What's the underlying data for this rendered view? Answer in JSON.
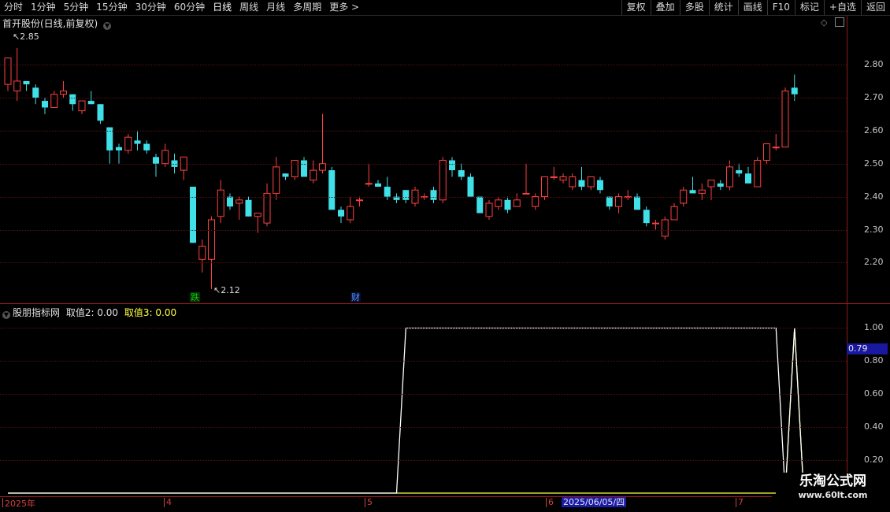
{
  "toolbar": {
    "periods": [
      "分时",
      "1分钟",
      "5分钟",
      "15分钟",
      "30分钟",
      "60分钟",
      "日线",
      "周线",
      "月线",
      "多周期",
      "更多 >"
    ],
    "active_period": "日线",
    "actions": [
      "复权",
      "叠加",
      "多股",
      "统计",
      "画线",
      "F10",
      "标记",
      "+自选",
      "返回"
    ]
  },
  "main_panel": {
    "title": "首开股份(日线,前复权)",
    "max_label": "2.85",
    "min_label": "2.12",
    "price_axis": [
      "2.80",
      "2.70",
      "2.60",
      "2.50",
      "2.40",
      "2.30",
      "2.20"
    ],
    "marks": [
      {
        "text": "跌",
        "color": "#00cc00"
      },
      {
        "text": "财",
        "color": "#4d9cff"
      }
    ]
  },
  "indicator_panel": {
    "title": "股朋指标网",
    "value2_label": "取值2: 0.00",
    "value3_label": "取值3: 0.00",
    "axis": [
      "1.00",
      "0.80",
      "0.60",
      "0.40",
      "0.20"
    ],
    "cursor_value": "0.79"
  },
  "date_axis": {
    "ticks": [
      "2025年",
      "4",
      "5",
      "6",
      "7"
    ],
    "highlight": "2025/06/05/四"
  },
  "watermark": {
    "title": "乐淘公式网",
    "url": "www.60lt.com"
  },
  "colors": {
    "up": "#ff4040",
    "down": "#40e0e8",
    "line_white": "#ffffff",
    "line_yellow": "#ffff44",
    "grid": "#5a1010"
  },
  "chart_data": {
    "type": "candlestick",
    "ylim": [
      2.12,
      2.85
    ],
    "candles": [
      {
        "o": 2.74,
        "h": 2.82,
        "l": 2.72,
        "c": 2.82
      },
      {
        "o": 2.72,
        "h": 2.85,
        "l": 2.69,
        "c": 2.75
      },
      {
        "o": 2.75,
        "h": 2.74,
        "l": 2.72,
        "c": 2.74
      },
      {
        "o": 2.73,
        "h": 2.74,
        "l": 2.68,
        "c": 2.7
      },
      {
        "o": 2.69,
        "h": 2.7,
        "l": 2.65,
        "c": 2.67
      },
      {
        "o": 2.67,
        "h": 2.72,
        "l": 2.67,
        "c": 2.71
      },
      {
        "o": 2.71,
        "h": 2.75,
        "l": 2.7,
        "c": 2.72
      },
      {
        "o": 2.71,
        "h": 2.71,
        "l": 2.66,
        "c": 2.68
      },
      {
        "o": 2.66,
        "h": 2.69,
        "l": 2.65,
        "c": 2.69
      },
      {
        "o": 2.69,
        "h": 2.72,
        "l": 2.68,
        "c": 2.68
      },
      {
        "o": 2.68,
        "h": 2.68,
        "l": 2.62,
        "c": 2.63
      },
      {
        "o": 2.61,
        "h": 2.61,
        "l": 2.5,
        "c": 2.54
      },
      {
        "o": 2.55,
        "h": 2.56,
        "l": 2.5,
        "c": 2.54
      },
      {
        "o": 2.54,
        "h": 2.59,
        "l": 2.53,
        "c": 2.58
      },
      {
        "o": 2.57,
        "h": 2.6,
        "l": 2.54,
        "c": 2.56
      },
      {
        "o": 2.56,
        "h": 2.57,
        "l": 2.53,
        "c": 2.54
      },
      {
        "o": 2.52,
        "h": 2.53,
        "l": 2.46,
        "c": 2.5
      },
      {
        "o": 2.5,
        "h": 2.56,
        "l": 2.49,
        "c": 2.54
      },
      {
        "o": 2.51,
        "h": 2.53,
        "l": 2.47,
        "c": 2.49
      },
      {
        "o": 2.48,
        "h": 2.52,
        "l": 2.45,
        "c": 2.52
      },
      {
        "o": 2.43,
        "h": 2.43,
        "l": 2.26,
        "c": 2.26
      },
      {
        "o": 2.21,
        "h": 2.27,
        "l": 2.17,
        "c": 2.25
      },
      {
        "o": 2.21,
        "h": 2.34,
        "l": 2.12,
        "c": 2.33
      },
      {
        "o": 2.34,
        "h": 2.45,
        "l": 2.32,
        "c": 2.42
      },
      {
        "o": 2.4,
        "h": 2.41,
        "l": 2.36,
        "c": 2.37
      },
      {
        "o": 2.38,
        "h": 2.4,
        "l": 2.33,
        "c": 2.39
      },
      {
        "o": 2.39,
        "h": 2.4,
        "l": 2.34,
        "c": 2.34
      },
      {
        "o": 2.34,
        "h": 2.35,
        "l": 2.29,
        "c": 2.35
      },
      {
        "o": 2.32,
        "h": 2.44,
        "l": 2.31,
        "c": 2.41
      },
      {
        "o": 2.41,
        "h": 2.52,
        "l": 2.39,
        "c": 2.49
      },
      {
        "o": 2.47,
        "h": 2.47,
        "l": 2.45,
        "c": 2.46
      },
      {
        "o": 2.46,
        "h": 2.51,
        "l": 2.45,
        "c": 2.51
      },
      {
        "o": 2.51,
        "h": 2.52,
        "l": 2.46,
        "c": 2.46
      },
      {
        "o": 2.45,
        "h": 2.51,
        "l": 2.44,
        "c": 2.48
      },
      {
        "o": 2.48,
        "h": 2.65,
        "l": 2.47,
        "c": 2.5
      },
      {
        "o": 2.48,
        "h": 2.49,
        "l": 2.36,
        "c": 2.36
      },
      {
        "o": 2.36,
        "h": 2.37,
        "l": 2.32,
        "c": 2.34
      },
      {
        "o": 2.33,
        "h": 2.4,
        "l": 2.32,
        "c": 2.37
      },
      {
        "o": 2.39,
        "h": 2.4,
        "l": 2.37,
        "c": 2.39
      },
      {
        "o": 2.44,
        "h": 2.5,
        "l": 2.43,
        "c": 2.44
      },
      {
        "o": 2.44,
        "h": 2.45,
        "l": 2.43,
        "c": 2.43
      },
      {
        "o": 2.43,
        "h": 2.46,
        "l": 2.39,
        "c": 2.4
      },
      {
        "o": 2.4,
        "h": 2.41,
        "l": 2.38,
        "c": 2.39
      },
      {
        "o": 2.42,
        "h": 2.42,
        "l": 2.38,
        "c": 2.39
      },
      {
        "o": 2.38,
        "h": 2.43,
        "l": 2.37,
        "c": 2.42
      },
      {
        "o": 2.4,
        "h": 2.41,
        "l": 2.39,
        "c": 2.4
      },
      {
        "o": 2.42,
        "h": 2.43,
        "l": 2.38,
        "c": 2.39
      },
      {
        "o": 2.39,
        "h": 2.52,
        "l": 2.38,
        "c": 2.51
      },
      {
        "o": 2.51,
        "h": 2.52,
        "l": 2.46,
        "c": 2.48
      },
      {
        "o": 2.48,
        "h": 2.5,
        "l": 2.45,
        "c": 2.46
      },
      {
        "o": 2.46,
        "h": 2.47,
        "l": 2.4,
        "c": 2.4
      },
      {
        "o": 2.4,
        "h": 2.4,
        "l": 2.35,
        "c": 2.35
      },
      {
        "o": 2.34,
        "h": 2.39,
        "l": 2.33,
        "c": 2.38
      },
      {
        "o": 2.37,
        "h": 2.4,
        "l": 2.36,
        "c": 2.39
      },
      {
        "o": 2.39,
        "h": 2.4,
        "l": 2.35,
        "c": 2.36
      },
      {
        "o": 2.37,
        "h": 2.41,
        "l": 2.37,
        "c": 2.39
      },
      {
        "o": 2.41,
        "h": 2.5,
        "l": 2.41,
        "c": 2.41
      },
      {
        "o": 2.37,
        "h": 2.41,
        "l": 2.36,
        "c": 2.4
      },
      {
        "o": 2.4,
        "h": 2.46,
        "l": 2.39,
        "c": 2.46
      },
      {
        "o": 2.46,
        "h": 2.49,
        "l": 2.45,
        "c": 2.46
      },
      {
        "o": 2.45,
        "h": 2.47,
        "l": 2.44,
        "c": 2.46
      },
      {
        "o": 2.43,
        "h": 2.47,
        "l": 2.42,
        "c": 2.46
      },
      {
        "o": 2.45,
        "h": 2.49,
        "l": 2.42,
        "c": 2.43
      },
      {
        "o": 2.43,
        "h": 2.46,
        "l": 2.42,
        "c": 2.46
      },
      {
        "o": 2.45,
        "h": 2.46,
        "l": 2.41,
        "c": 2.42
      },
      {
        "o": 2.4,
        "h": 2.4,
        "l": 2.36,
        "c": 2.37
      },
      {
        "o": 2.37,
        "h": 2.41,
        "l": 2.35,
        "c": 2.4
      },
      {
        "o": 2.4,
        "h": 2.42,
        "l": 2.39,
        "c": 2.4
      },
      {
        "o": 2.4,
        "h": 2.41,
        "l": 2.36,
        "c": 2.36
      },
      {
        "o": 2.36,
        "h": 2.37,
        "l": 2.31,
        "c": 2.32
      },
      {
        "o": 2.32,
        "h": 2.33,
        "l": 2.3,
        "c": 2.32
      },
      {
        "o": 2.28,
        "h": 2.34,
        "l": 2.27,
        "c": 2.33
      },
      {
        "o": 2.33,
        "h": 2.38,
        "l": 2.33,
        "c": 2.37
      },
      {
        "o": 2.38,
        "h": 2.43,
        "l": 2.37,
        "c": 2.42
      },
      {
        "o": 2.42,
        "h": 2.46,
        "l": 2.41,
        "c": 2.41
      },
      {
        "o": 2.41,
        "h": 2.44,
        "l": 2.39,
        "c": 2.42
      },
      {
        "o": 2.43,
        "h": 2.44,
        "l": 2.39,
        "c": 2.45
      },
      {
        "o": 2.44,
        "h": 2.45,
        "l": 2.42,
        "c": 2.43
      },
      {
        "o": 2.43,
        "h": 2.51,
        "l": 2.42,
        "c": 2.49
      },
      {
        "o": 2.48,
        "h": 2.5,
        "l": 2.46,
        "c": 2.47
      },
      {
        "o": 2.47,
        "h": 2.49,
        "l": 2.44,
        "c": 2.44
      },
      {
        "o": 2.43,
        "h": 2.52,
        "l": 2.43,
        "c": 2.51
      },
      {
        "o": 2.51,
        "h": 2.56,
        "l": 2.5,
        "c": 2.56
      },
      {
        "o": 2.55,
        "h": 2.59,
        "l": 2.54,
        "c": 2.55
      },
      {
        "o": 2.55,
        "h": 2.73,
        "l": 2.55,
        "c": 2.72
      },
      {
        "o": 2.73,
        "h": 2.77,
        "l": 2.69,
        "c": 2.71
      }
    ],
    "indicator": {
      "ylim": [
        0,
        1.05
      ],
      "white_series": [
        0,
        0,
        0,
        0,
        0,
        0,
        0,
        0,
        0,
        0,
        0,
        0,
        0,
        0,
        0,
        0,
        0,
        0,
        0,
        0,
        0,
        0,
        0,
        0,
        0,
        0,
        0,
        0,
        0,
        0,
        0,
        0,
        0,
        0,
        0,
        0,
        0,
        0,
        0,
        0,
        0,
        0,
        0,
        1,
        1,
        1,
        1,
        1,
        1,
        1,
        1,
        1,
        1,
        1,
        1,
        1,
        1,
        1,
        1,
        1,
        1,
        1,
        1,
        1,
        1,
        1,
        1,
        1,
        1,
        1,
        1,
        1,
        1,
        1,
        1,
        1,
        1,
        1,
        1,
        1,
        1,
        1,
        1,
        1,
        0,
        1,
        0
      ],
      "yellow_series": [
        0,
        0,
        0,
        0,
        0,
        0,
        0,
        0,
        0,
        0,
        0,
        0,
        0,
        0,
        0,
        0,
        0,
        0,
        0,
        0,
        0,
        0,
        0,
        0,
        0,
        0,
        0,
        0,
        0,
        0,
        0,
        0,
        0,
        0,
        0,
        0,
        0,
        0,
        0,
        0,
        0,
        0,
        0,
        0,
        0,
        0,
        0,
        0,
        0,
        0,
        0,
        0,
        0,
        0,
        0,
        0,
        0,
        0,
        0,
        0,
        0,
        0,
        0,
        0,
        0,
        0,
        0,
        0,
        0,
        0,
        0,
        0,
        0,
        0,
        0,
        0,
        0,
        0,
        0,
        0,
        0,
        0,
        0,
        0,
        0,
        1,
        0
      ]
    }
  }
}
